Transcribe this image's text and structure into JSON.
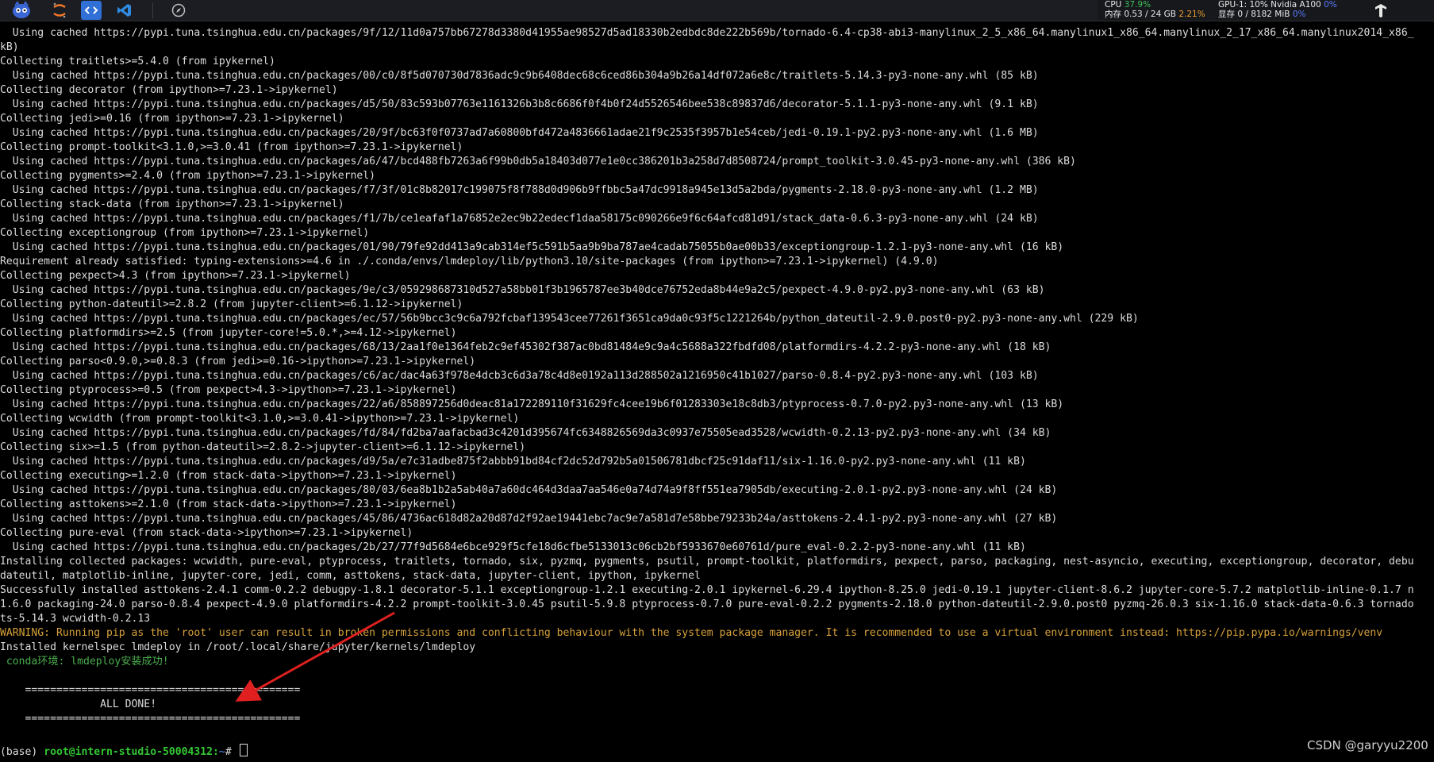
{
  "taskbar": {
    "icons": [
      "app-mascot-icon",
      "jupyter-icon",
      "vscode-remote-icon",
      "vscode-icon",
      "compass-icon"
    ],
    "stats": {
      "cpu_label": "CPU",
      "cpu_value": "37.9%",
      "mem_label": "内存 0.53 / 24 GB",
      "mem_value": "2.21%",
      "gpu_label": "GPU-1: 10% Nvidia A100",
      "gpu_value": "0%",
      "vram_label": "显存 0 / 8182 MiB",
      "vram_value": "0%"
    },
    "colors": {
      "good": "#3fbf5a",
      "warn": "#f0a030",
      "info": "#5b7cff"
    }
  },
  "terminal": {
    "lines": [
      "  Using cached https://pypi.tuna.tsinghua.edu.cn/packages/9f/12/11d0a757bb67278d3380d41955ae98527d5ad18330b2edbdc8de222b569b/tornado-6.4-cp38-abi3-manylinux_2_5_x86_64.manylinux1_x86_64.manylinux_2_17_x86_64.manylinux2014_x86_",
      "kB)",
      "Collecting traitlets>=5.4.0 (from ipykernel)",
      "  Using cached https://pypi.tuna.tsinghua.edu.cn/packages/00/c0/8f5d070730d7836adc9c9b6408dec68c6ced86b304a9b26a14df072a6e8c/traitlets-5.14.3-py3-none-any.whl (85 kB)",
      "Collecting decorator (from ipython>=7.23.1->ipykernel)",
      "  Using cached https://pypi.tuna.tsinghua.edu.cn/packages/d5/50/83c593b07763e1161326b3b8c6686f0f4b0f24d5526546bee538c89837d6/decorator-5.1.1-py3-none-any.whl (9.1 kB)",
      "Collecting jedi>=0.16 (from ipython>=7.23.1->ipykernel)",
      "  Using cached https://pypi.tuna.tsinghua.edu.cn/packages/20/9f/bc63f0f0737ad7a60800bfd472a4836661adae21f9c2535f3957b1e54ceb/jedi-0.19.1-py2.py3-none-any.whl (1.6 MB)",
      "Collecting prompt-toolkit<3.1.0,>=3.0.41 (from ipython>=7.23.1->ipykernel)",
      "  Using cached https://pypi.tuna.tsinghua.edu.cn/packages/a6/47/bcd488fb7263a6f99b0db5a18403d077e1e0cc386201b3a258d7d8508724/prompt_toolkit-3.0.45-py3-none-any.whl (386 kB)",
      "Collecting pygments>=2.4.0 (from ipython>=7.23.1->ipykernel)",
      "  Using cached https://pypi.tuna.tsinghua.edu.cn/packages/f7/3f/01c8b82017c199075f8f788d0d906b9ffbbc5a47dc9918a945e13d5a2bda/pygments-2.18.0-py3-none-any.whl (1.2 MB)",
      "Collecting stack-data (from ipython>=7.23.1->ipykernel)",
      "  Using cached https://pypi.tuna.tsinghua.edu.cn/packages/f1/7b/ce1eafaf1a76852e2ec9b22edecf1daa58175c090266e9f6c64afcd81d91/stack_data-0.6.3-py3-none-any.whl (24 kB)",
      "Collecting exceptiongroup (from ipython>=7.23.1->ipykernel)",
      "  Using cached https://pypi.tuna.tsinghua.edu.cn/packages/01/90/79fe92dd413a9cab314ef5c591b5aa9b9ba787ae4cadab75055b0ae00b33/exceptiongroup-1.2.1-py3-none-any.whl (16 kB)",
      "Requirement already satisfied: typing-extensions>=4.6 in ./.conda/envs/lmdeploy/lib/python3.10/site-packages (from ipython>=7.23.1->ipykernel) (4.9.0)",
      "Collecting pexpect>4.3 (from ipython>=7.23.1->ipykernel)",
      "  Using cached https://pypi.tuna.tsinghua.edu.cn/packages/9e/c3/059298687310d527a58bb01f3b1965787ee3b40dce76752eda8b44e9a2c5/pexpect-4.9.0-py2.py3-none-any.whl (63 kB)",
      "Collecting python-dateutil>=2.8.2 (from jupyter-client>=6.1.12->ipykernel)",
      "  Using cached https://pypi.tuna.tsinghua.edu.cn/packages/ec/57/56b9bcc3c9c6a792fcbaf139543cee77261f3651ca9da0c93f5c1221264b/python_dateutil-2.9.0.post0-py2.py3-none-any.whl (229 kB)",
      "Collecting platformdirs>=2.5 (from jupyter-core!=5.0.*,>=4.12->ipykernel)",
      "  Using cached https://pypi.tuna.tsinghua.edu.cn/packages/68/13/2aa1f0e1364feb2c9ef45302f387ac0bd81484e9c9a4c5688a322fbdfd08/platformdirs-4.2.2-py3-none-any.whl (18 kB)",
      "Collecting parso<0.9.0,>=0.8.3 (from jedi>=0.16->ipython>=7.23.1->ipykernel)",
      "  Using cached https://pypi.tuna.tsinghua.edu.cn/packages/c6/ac/dac4a63f978e4dcb3c6d3a78c4d8e0192a113d288502a1216950c41b1027/parso-0.8.4-py2.py3-none-any.whl (103 kB)",
      "Collecting ptyprocess>=0.5 (from pexpect>4.3->ipython>=7.23.1->ipykernel)",
      "  Using cached https://pypi.tuna.tsinghua.edu.cn/packages/22/a6/858897256d0deac81a172289110f31629fc4cee19b6f01283303e18c8db3/ptyprocess-0.7.0-py2.py3-none-any.whl (13 kB)",
      "Collecting wcwidth (from prompt-toolkit<3.1.0,>=3.0.41->ipython>=7.23.1->ipykernel)",
      "  Using cached https://pypi.tuna.tsinghua.edu.cn/packages/fd/84/fd2ba7aafacbad3c4201d395674fc6348826569da3c0937e75505ead3528/wcwidth-0.2.13-py2.py3-none-any.whl (34 kB)",
      "Collecting six>=1.5 (from python-dateutil>=2.8.2->jupyter-client>=6.1.12->ipykernel)",
      "  Using cached https://pypi.tuna.tsinghua.edu.cn/packages/d9/5a/e7c31adbe875f2abbb91bd84cf2dc52d792b5a01506781dbcf25c91daf11/six-1.16.0-py2.py3-none-any.whl (11 kB)",
      "Collecting executing>=1.2.0 (from stack-data->ipython>=7.23.1->ipykernel)",
      "  Using cached https://pypi.tuna.tsinghua.edu.cn/packages/80/03/6ea8b1b2a5ab40a7a60dc464d3daa7aa546e0a74d74a9f8ff551ea7905db/executing-2.0.1-py2.py3-none-any.whl (24 kB)",
      "Collecting asttokens>=2.1.0 (from stack-data->ipython>=7.23.1->ipykernel)",
      "  Using cached https://pypi.tuna.tsinghua.edu.cn/packages/45/86/4736ac618d82a20d87d2f92ae19441ebc7ac9e7a581d7e58bbe79233b24a/asttokens-2.4.1-py2.py3-none-any.whl (27 kB)",
      "Collecting pure-eval (from stack-data->ipython>=7.23.1->ipykernel)",
      "  Using cached https://pypi.tuna.tsinghua.edu.cn/packages/2b/27/77f9d5684e6bce929f5cfe18d6cfbe5133013c06cb2bf5933670e60761d/pure_eval-0.2.2-py3-none-any.whl (11 kB)",
      "Installing collected packages: wcwidth, pure-eval, ptyprocess, traitlets, tornado, six, pyzmq, pygments, psutil, prompt-toolkit, platformdirs, pexpect, parso, packaging, nest-asyncio, executing, exceptiongroup, decorator, debu",
      "dateutil, matplotlib-inline, jupyter-core, jedi, comm, asttokens, stack-data, jupyter-client, ipython, ipykernel",
      "Successfully installed asttokens-2.4.1 comm-0.2.2 debugpy-1.8.1 decorator-5.1.1 exceptiongroup-1.2.1 executing-2.0.1 ipykernel-6.29.4 ipython-8.25.0 jedi-0.19.1 jupyter-client-8.6.2 jupyter-core-5.7.2 matplotlib-inline-0.1.7 n",
      "1.6.0 packaging-24.0 parso-0.8.4 pexpect-4.9.0 platformdirs-4.2.2 prompt-toolkit-3.0.45 psutil-5.9.8 ptyprocess-0.7.0 pure-eval-0.2.2 pygments-2.18.0 python-dateutil-2.9.0.post0 pyzmq-26.0.3 six-1.16.0 stack-data-0.6.3 tornado",
      "ts-5.14.3 wcwidth-0.2.13"
    ],
    "warning": "WARNING: Running pip as the 'root' user can result in broken permissions and conflicting behaviour with the system package manager. It is recommended to use a virtual environment instead: https://pip.pypa.io/warnings/venv",
    "kernelspec": "Installed kernelspec lmdeploy in /root/.local/share/jupyter/kernels/lmdeploy",
    "success": " conda环境: lmdeploy安装成功!",
    "rule_top": "    ============================================",
    "done": "                ALL DONE!",
    "rule_bottom": "    ============================================",
    "prompt": {
      "env": "(base) ",
      "user": "root@intern-studio-50004312:",
      "path": "~",
      "symbol": "# "
    },
    "colors": {
      "text": "#dcdcdc",
      "warning": "#d7a13a",
      "success": "#4caf50",
      "arrow": "#e02020"
    }
  },
  "watermark": "CSDN @garyyu2200"
}
